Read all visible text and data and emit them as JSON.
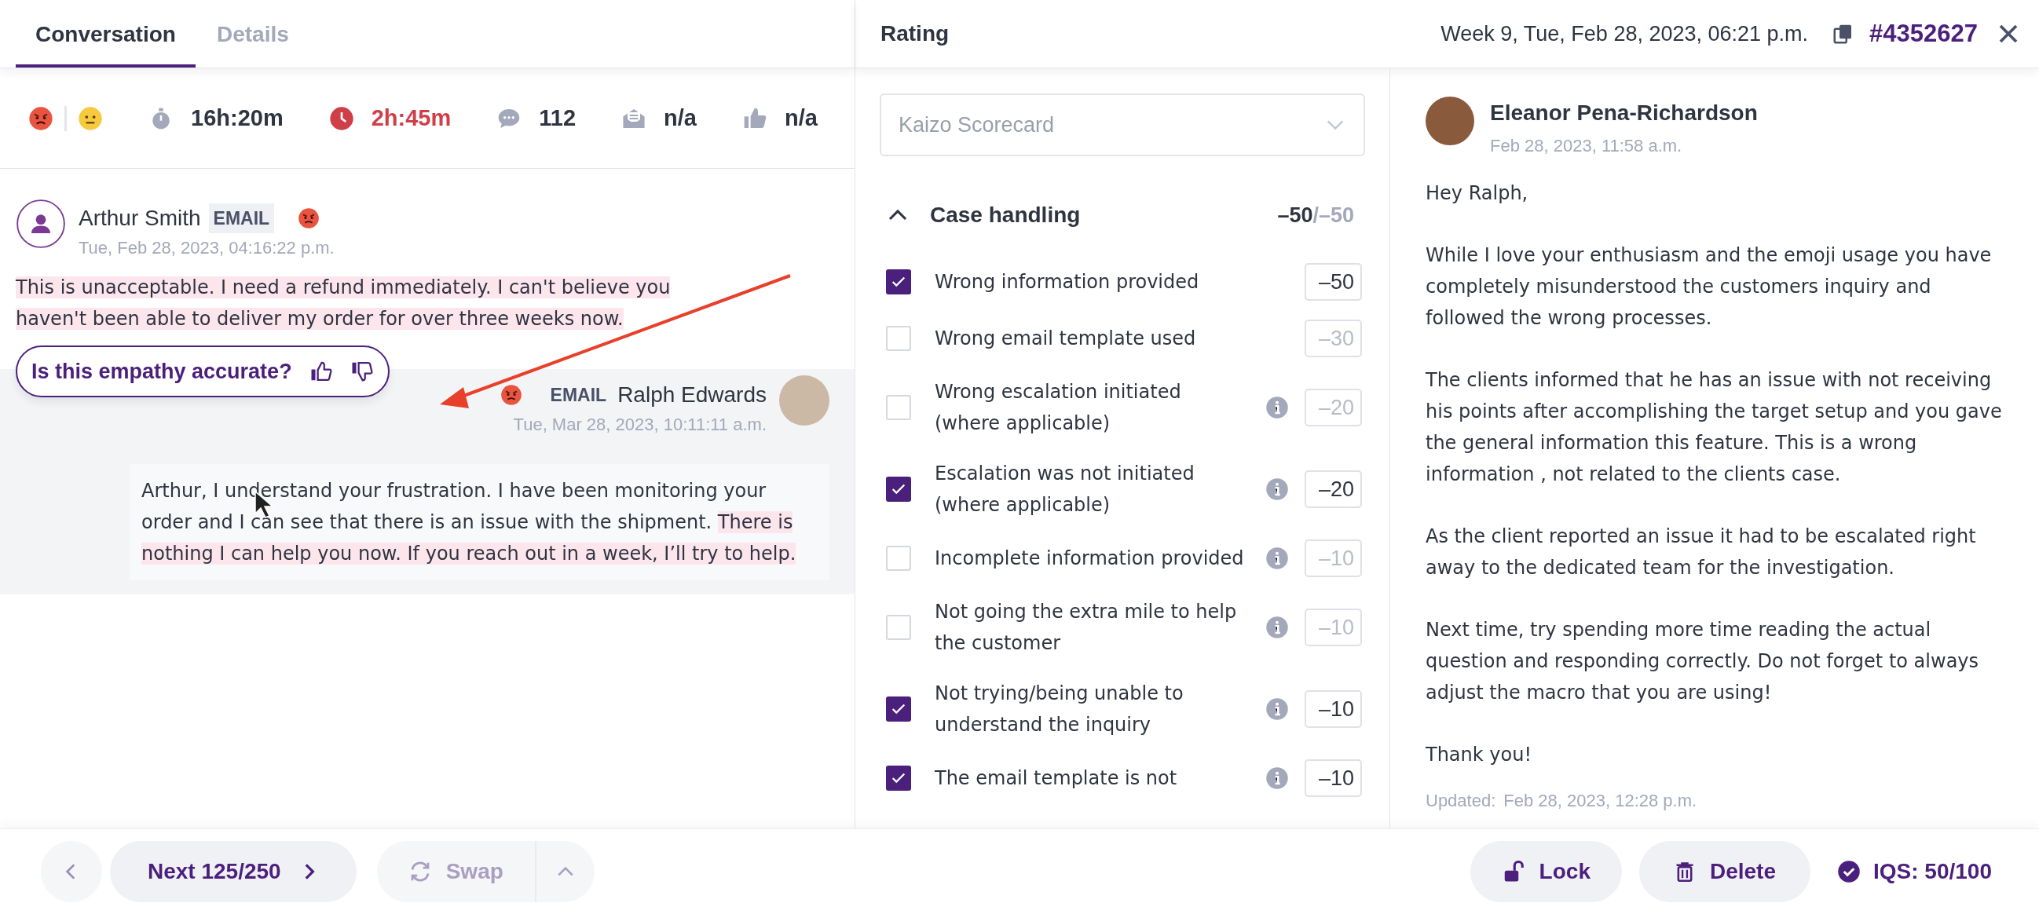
{
  "tabs": [
    {
      "label": "Conversation",
      "selected": true
    },
    {
      "label": "Details",
      "selected": false
    }
  ],
  "sentiments": [
    {
      "kind": "angry"
    },
    {
      "kind": "neutral"
    }
  ],
  "stats": [
    {
      "kind": "timer",
      "value": "16h:20m",
      "alert": false
    },
    {
      "kind": "clock",
      "value": "2h:45m",
      "alert": true
    },
    {
      "kind": "comments",
      "value": "112",
      "alert": false
    },
    {
      "kind": "mail",
      "value": "n/a",
      "alert": false
    },
    {
      "kind": "thumb",
      "value": "n/a",
      "alert": false
    }
  ],
  "messages": [
    {
      "kind": "customer",
      "author": "Arthur Smith",
      "channel": "EMAIL",
      "sentiment": {
        "kind": "angry"
      },
      "time": "Tue, Feb 28, 2023, 04:16:22 p.m.",
      "segments": [
        {
          "text": "This is unacceptable. I need a refund immediately. I can't believe you haven't been able to deliver my order for over three weeks now.",
          "highlighted": true
        }
      ]
    },
    {
      "kind": "agent",
      "author": "Ralph Edwards",
      "channel": "EMAIL",
      "sentiment": {
        "kind": "angry"
      },
      "time": "Tue, Mar 28, 2023, 10:11:11 a.m.",
      "segments": [
        {
          "text": "Arthur, I understand your frustration. I have been monitoring your order and I can see that there is an issue with the shipment. ",
          "highlighted": false
        },
        {
          "text": "There is nothing I can help you now. If you reach out in a week, I’ll try to help.",
          "highlighted": true
        }
      ]
    }
  ],
  "empathy_prompt": {
    "question": "Is this empathy accurate?"
  },
  "header": {
    "title": "Rating",
    "date": "Week 9, Tue, Feb 28, 2023, 06:21 p.m.",
    "ticket": "#4352627"
  },
  "scorecard": {
    "value": "Kaizo Scorecard"
  },
  "category": {
    "name": "Case handling",
    "expanded": true,
    "score": "–50",
    "max": "/–50"
  },
  "items": [
    {
      "label": "Wrong information provided",
      "checked": true,
      "info": false,
      "value": "–50"
    },
    {
      "label": "Wrong email template used",
      "checked": false,
      "info": false,
      "value": "–30"
    },
    {
      "label": "Wrong escalation initiated (where applicable)",
      "checked": false,
      "info": true,
      "value": "–20"
    },
    {
      "label": "Escalation was not initiated (where applicable)",
      "checked": true,
      "info": true,
      "value": "–20"
    },
    {
      "label": "Incomplete information provided",
      "checked": false,
      "info": true,
      "value": "–10"
    },
    {
      "label": "Not going the extra mile to help the customer",
      "checked": false,
      "info": true,
      "value": "–10"
    },
    {
      "label": "Not trying/being unable to understand the inquiry",
      "checked": true,
      "info": true,
      "value": "–10"
    },
    {
      "label": "The email template is not",
      "checked": true,
      "info": true,
      "value": "–10"
    }
  ],
  "review": {
    "author": "Eleanor Pena-Richardson",
    "time": "Feb 28, 2023, 11:58 a.m.",
    "paragraphs": [
      "Hey Ralph,",
      "While I love your enthusiasm and the emoji usage you have completely misunderstood the customers inquiry and followed the wrong processes.",
      "The clients informed that he has an issue with not receiving his points after accomplishing the target setup and you gave the general information this feature. This is a wrong information , not related to the clients case.",
      "As the client reported an issue it had to be escalated right away to the dedicated team for the investigation.",
      "Next time, try spending more time reading the actual question and responding correctly. Do not forget to always adjust the macro that you are using!",
      "Thank you!"
    ],
    "updated_label": "Updated:",
    "updated_time": "Feb 28, 2023, 12:28 p.m."
  },
  "footer": {
    "next": "Next 125/250",
    "swap": {
      "label": "Swap",
      "disabled": true
    },
    "lock": "Lock",
    "delete": "Delete",
    "iqs": "IQS: 50/100"
  }
}
